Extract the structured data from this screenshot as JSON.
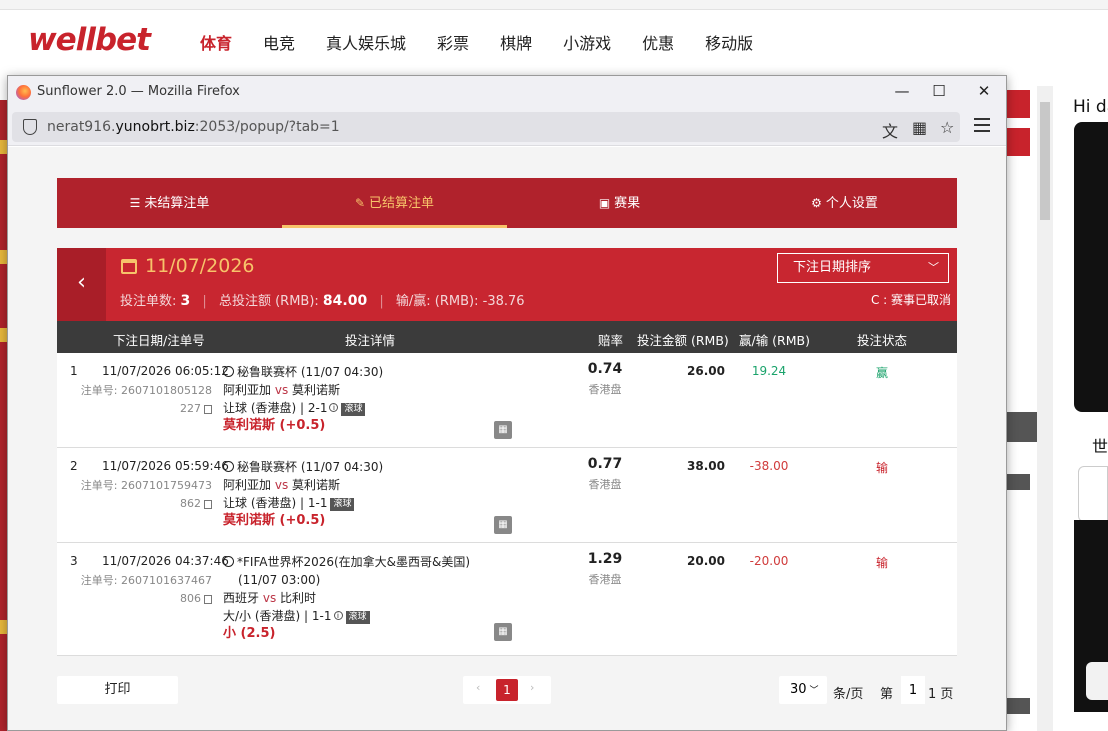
{
  "site": {
    "logo": "wellbet",
    "nav": [
      "体育",
      "电竞",
      "真人娱乐城",
      "彩票",
      "棋牌",
      "小游戏",
      "优惠",
      "移动版"
    ],
    "greeting": "Hi da",
    "world_label": "世"
  },
  "window": {
    "title": "Sunflower 2.0 — Mozilla Firefox",
    "url_prefix": "nerat916.",
    "url_host": "yunobrt.biz",
    "url_rest": ":2053/popup/?tab=1",
    "controls": {
      "minimize": "—",
      "maximize": "☐",
      "close": "✕"
    }
  },
  "tabs": [
    {
      "label": "未结算注单",
      "icon": "list-icon"
    },
    {
      "label": "已结算注单",
      "icon": "settled-icon",
      "active": true
    },
    {
      "label": "赛果",
      "icon": "scoreboard-icon"
    },
    {
      "label": "个人设置",
      "icon": "gear-icon"
    }
  ],
  "summary": {
    "date": "11/07/2026",
    "count_label": "投注单数:",
    "count": "3",
    "total_label": "总投注额 (RMB):",
    "total": "84.00",
    "pnl_label": "输/赢: (RMB):",
    "pnl": "-38.76",
    "sort_label": "下注日期排序",
    "cancel_note": "C : 赛事已取消"
  },
  "columns": {
    "date": "下注日期/注单号",
    "detail": "投注详情",
    "odds": "赔率",
    "stake": "投注金额 (RMB)",
    "pnl": "赢/输 (RMB)",
    "status": "投注状态"
  },
  "bets": [
    {
      "index": "1",
      "datetime": "11/07/2026 06:05:12",
      "order_label": "注单号:",
      "order_no": "2607101805128227",
      "league": "秘鲁联赛杯 (11/07 04:30)",
      "home": "阿利亚加",
      "vs": "vs",
      "away": "莫利诺斯",
      "market": "让球 (香港盘)",
      "score": "2-1",
      "live_tag": "滚球",
      "pick": "莫利诺斯 (+0.5)",
      "odds": "0.74",
      "odds_type": "香港盘",
      "stake": "26.00",
      "pnl": "19.24",
      "status": "赢",
      "result": "win"
    },
    {
      "index": "2",
      "datetime": "11/07/2026 05:59:46",
      "order_label": "注单号:",
      "order_no": "2607101759473862",
      "league": "秘鲁联赛杯 (11/07 04:30)",
      "home": "阿利亚加",
      "vs": "vs",
      "away": "莫利诺斯",
      "market": "让球 (香港盘)",
      "score": "1-1",
      "live_tag": "滚球",
      "pick": "莫利诺斯 (+0.5)",
      "odds": "0.77",
      "odds_type": "香港盘",
      "stake": "38.00",
      "pnl": "-38.00",
      "status": "输",
      "result": "lose"
    },
    {
      "index": "3",
      "datetime": "11/07/2026 04:37:46",
      "order_label": "注单号:",
      "order_no": "2607101637467806",
      "league": "*FIFA世界杯2026(在加拿大&墨西哥&美国)",
      "league_time": "(11/07 03:00)",
      "home": "西班牙",
      "vs": "vs",
      "away": "比利时",
      "market": "大/小 (香港盘)",
      "score": "1-1",
      "live_tag": "滚球",
      "pick": "小 (2.5)",
      "odds": "1.29",
      "odds_type": "香港盘",
      "stake": "20.00",
      "pnl": "-20.00",
      "status": "输",
      "result": "lose"
    }
  ],
  "footer": {
    "print": "打印",
    "current_page": "1",
    "prev": "‹",
    "next": "›",
    "per_page": "30",
    "per_page_unit": "条/页",
    "goto_prefix": "第",
    "goto_value": "1",
    "goto_suffix": "1 页"
  }
}
